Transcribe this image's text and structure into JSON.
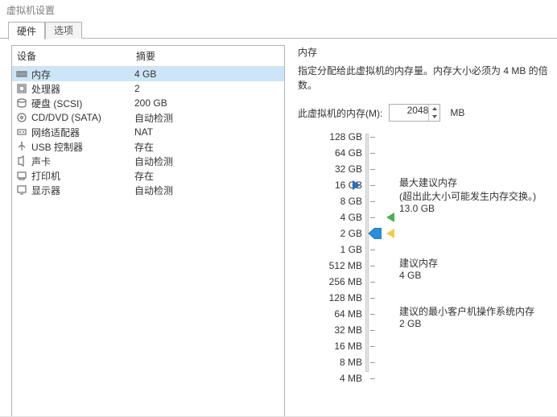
{
  "window": {
    "title": "虚拟机设置"
  },
  "tabs": {
    "hardware": "硬件",
    "options": "选项"
  },
  "hw_table": {
    "col_device": "设备",
    "col_summary": "摘要",
    "rows": [
      {
        "name": "内存",
        "summary": "4 GB",
        "selected": true
      },
      {
        "name": "处理器",
        "summary": "2",
        "selected": false
      },
      {
        "name": "硬盘 (SCSI)",
        "summary": "200 GB",
        "selected": false
      },
      {
        "name": "CD/DVD (SATA)",
        "summary": "自动检测",
        "selected": false
      },
      {
        "name": "网络适配器",
        "summary": "NAT",
        "selected": false
      },
      {
        "name": "USB 控制器",
        "summary": "存在",
        "selected": false
      },
      {
        "name": "声卡",
        "summary": "自动检测",
        "selected": false
      },
      {
        "name": "打印机",
        "summary": "存在",
        "selected": false
      },
      {
        "name": "显示器",
        "summary": "自动检测",
        "selected": false
      }
    ]
  },
  "memory_panel": {
    "title": "内存",
    "desc": "指定分配给此虚拟机的内存量。内存大小必须为 4 MB 的倍数。",
    "field_label": "此虚拟机的内存(M):",
    "value": "2048",
    "unit": "MB"
  },
  "scale_labels": [
    "128 GB",
    "64 GB",
    "32 GB",
    "16 GB",
    "8 GB",
    "4 GB",
    "2 GB",
    "1 GB",
    "512 MB",
    "256 MB",
    "128 MB",
    "64 MB",
    "32 MB",
    "16 MB",
    "8 MB",
    "4 MB"
  ],
  "legend": {
    "max_title": "最大建议内存",
    "max_note": "(超出此大小可能发生内存交换。)",
    "max_value": "13.0 GB",
    "rec_title": "建议内存",
    "rec_value": "4 GB",
    "min_title": "建议的最小客户机操作系统内存",
    "min_value": "2 GB"
  },
  "icons": {
    "memory": "memory-icon",
    "cpu": "cpu-icon",
    "disk": "disk-icon",
    "cd": "cd-icon",
    "net": "net-icon",
    "usb": "usb-icon",
    "sound": "sound-icon",
    "printer": "printer-icon",
    "display": "display-icon"
  }
}
